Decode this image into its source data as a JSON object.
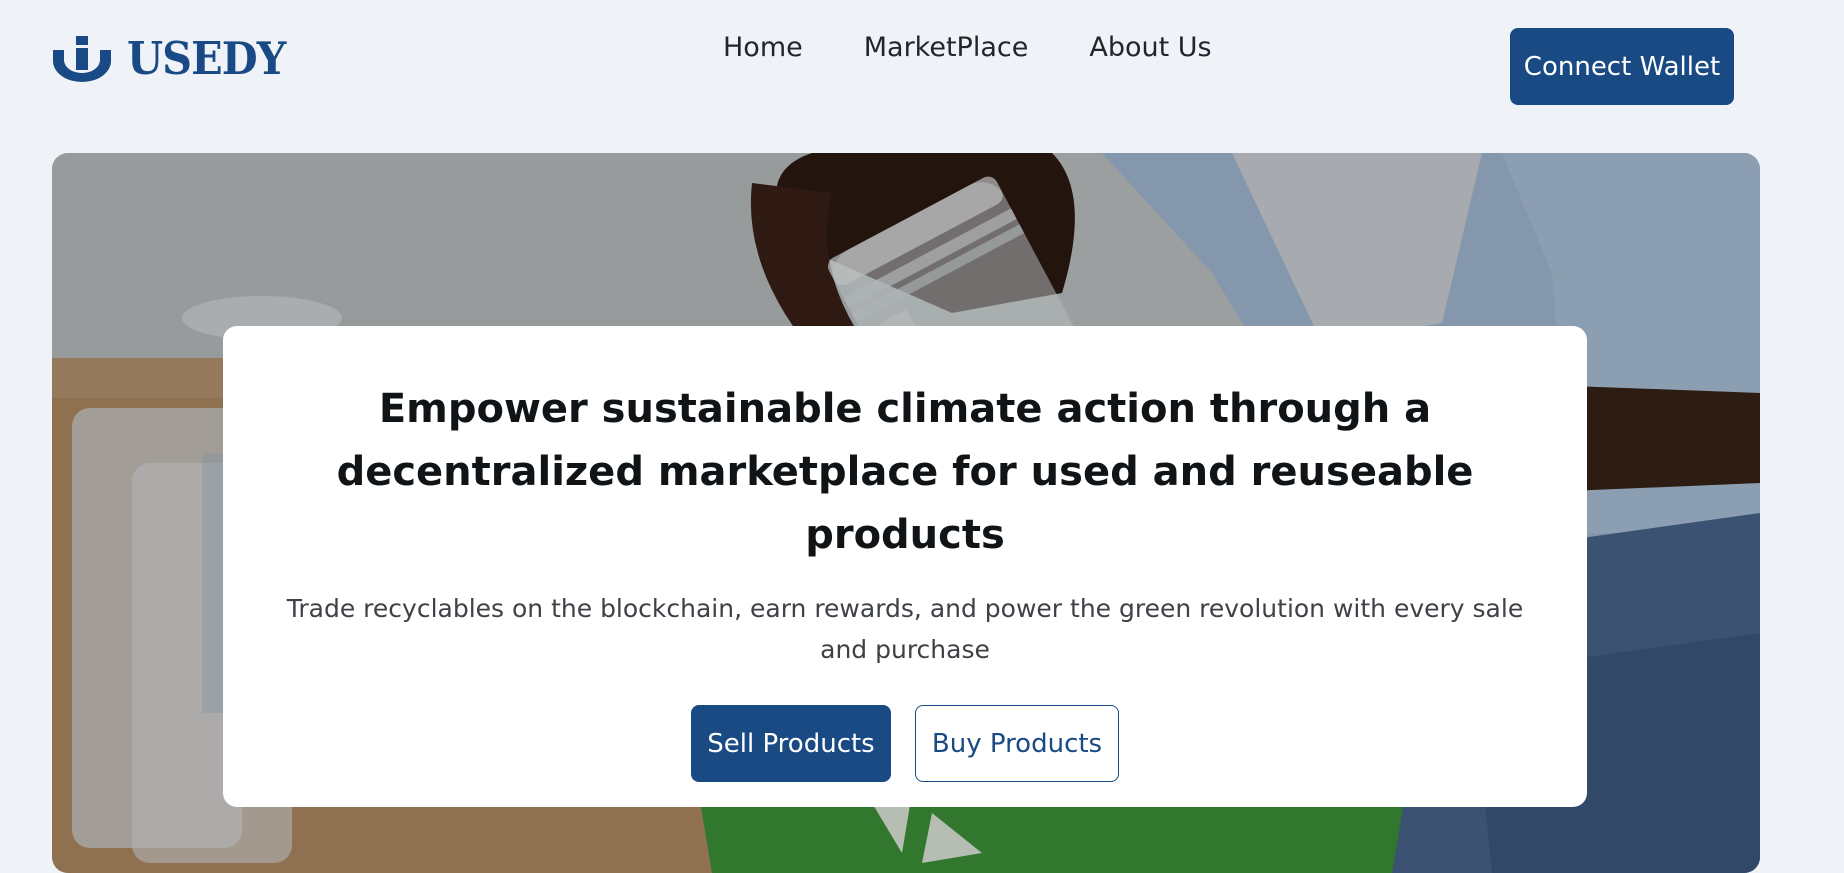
{
  "brand": {
    "name": "USEDY",
    "color": "#1a4a86"
  },
  "nav": {
    "links": [
      {
        "label": "Home"
      },
      {
        "label": "MarketPlace"
      },
      {
        "label": "About Us"
      }
    ],
    "connect_label": "Connect Wallet"
  },
  "hero": {
    "title": "Empower sustainable climate action through a decentralized marketplace for used and reuseable products",
    "subtitle": "Trade recyclables on the blockchain, earn rewards, and power the green revolution with every sale and purchase",
    "sell_label": "Sell Products",
    "buy_label": "Buy Products",
    "background_image": "person-holding-glass-jar-over-recycling-bin"
  },
  "colors": {
    "accent": "#194a84",
    "page_background": "#eff3f7",
    "title_text": "#111417",
    "body_text": "#3e4246"
  }
}
